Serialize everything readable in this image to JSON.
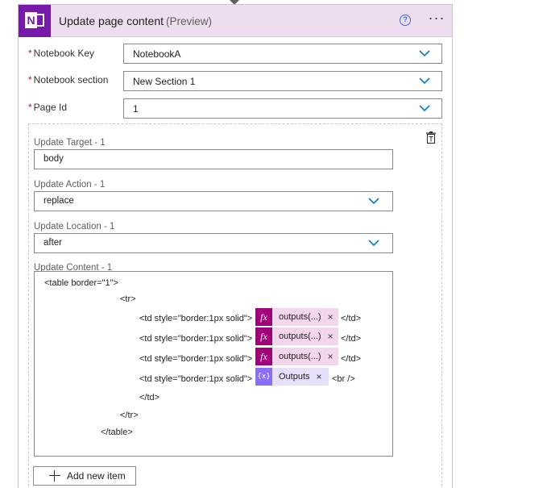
{
  "header": {
    "title": "Update page content",
    "preview": "(Preview)",
    "app_icon": "onenote-icon",
    "help_icon": "help-circle-icon",
    "more_icon": "more-options-icon",
    "theme_color": "#7719aa",
    "header_bg": "#eedcef"
  },
  "fields": {
    "notebook_key": {
      "label": "Notebook Key",
      "required_mark": "*",
      "value": "NotebookA"
    },
    "notebook_section": {
      "label": "Notebook section",
      "required_mark": "*",
      "value": "New Section 1"
    },
    "page_id": {
      "label": "Page Id",
      "required_mark": "*",
      "value": "1"
    }
  },
  "item": {
    "update_target": {
      "label": "Update Target - 1",
      "value": "body"
    },
    "update_action": {
      "label": "Update Action - 1",
      "value": "replace"
    },
    "update_location": {
      "label": "Update Location - 1",
      "value": "after"
    },
    "update_content": {
      "label": "Update Content - 1",
      "lines": {
        "table_open": "<table border=\"1\">",
        "tr_open": "<tr>",
        "td_open_1": "<td style=\"border:1px solid\">",
        "td_open_2": "<td style=\"border:1px solid\">",
        "td_open_3": "<td style=\"border:1px solid\">",
        "td_open_4": "<td style=\"border:1px solid\">",
        "td_close_1": "</td>",
        "td_close_2": "</td>",
        "td_close_3": "</td>",
        "td_close_4": "</td>",
        "br": "<br />",
        "tr_close": "</tr>",
        "table_close": "</table>"
      },
      "tokens": [
        {
          "type": "expression",
          "icon": "fx",
          "label": "outputs(...)",
          "remove": "×"
        },
        {
          "type": "expression",
          "icon": "fx",
          "label": "outputs(...)",
          "remove": "×"
        },
        {
          "type": "expression",
          "icon": "fx",
          "label": "outputs(...)",
          "remove": "×"
        },
        {
          "type": "variable",
          "icon": "{x}",
          "label": "Outputs",
          "remove": "×"
        }
      ]
    }
  },
  "add_button": {
    "label": "Add new item",
    "icon": "plus-icon"
  }
}
